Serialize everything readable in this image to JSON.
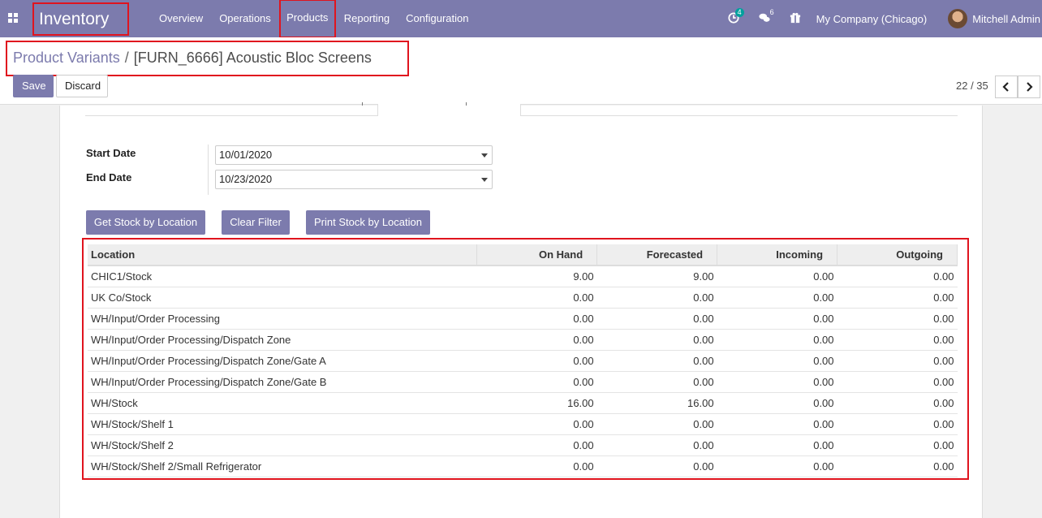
{
  "navbar": {
    "app_name": "Inventory",
    "menu": [
      "Overview",
      "Operations",
      "Products",
      "Reporting",
      "Configuration"
    ],
    "active_menu": "Products",
    "activity_count": "4",
    "message_count": "6",
    "company": "My Company (Chicago)",
    "user": "Mitchell Admin"
  },
  "breadcrumb": {
    "parent": "Product Variants",
    "separator": "/",
    "current": "[FURN_6666] Acoustic Bloc Screens"
  },
  "buttons": {
    "save": "Save",
    "discard": "Discard"
  },
  "pager": {
    "value": "22 / 35"
  },
  "form": {
    "start_date_label": "Start Date",
    "start_date_value": "10/01/2020",
    "end_date_label": "End Date",
    "end_date_value": "10/23/2020",
    "actions": [
      "Get Stock by Location",
      "Clear Filter",
      "Print Stock by Location"
    ]
  },
  "table": {
    "columns": [
      "Location",
      "On Hand",
      "Forecasted",
      "Incoming",
      "Outgoing"
    ],
    "rows": [
      [
        "CHIC1/Stock",
        "9.00",
        "9.00",
        "0.00",
        "0.00"
      ],
      [
        "UK Co/Stock",
        "0.00",
        "0.00",
        "0.00",
        "0.00"
      ],
      [
        "WH/Input/Order Processing",
        "0.00",
        "0.00",
        "0.00",
        "0.00"
      ],
      [
        "WH/Input/Order Processing/Dispatch Zone",
        "0.00",
        "0.00",
        "0.00",
        "0.00"
      ],
      [
        "WH/Input/Order Processing/Dispatch Zone/Gate A",
        "0.00",
        "0.00",
        "0.00",
        "0.00"
      ],
      [
        "WH/Input/Order Processing/Dispatch Zone/Gate B",
        "0.00",
        "0.00",
        "0.00",
        "0.00"
      ],
      [
        "WH/Stock",
        "16.00",
        "16.00",
        "0.00",
        "0.00"
      ],
      [
        "WH/Stock/Shelf 1",
        "0.00",
        "0.00",
        "0.00",
        "0.00"
      ],
      [
        "WH/Stock/Shelf 2",
        "0.00",
        "0.00",
        "0.00",
        "0.00"
      ],
      [
        "WH/Stock/Shelf 2/Small Refrigerator",
        "0.00",
        "0.00",
        "0.00",
        "0.00"
      ]
    ]
  },
  "colors": {
    "brand": "#7c7bad",
    "highlight": "#e0141e",
    "badge": "#00a09d"
  }
}
